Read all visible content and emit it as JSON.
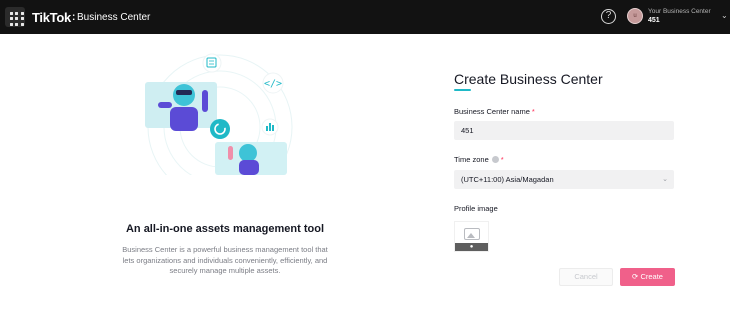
{
  "header": {
    "brand": "TikTok",
    "separator": ":",
    "product": "Business Center",
    "help_glyph": "?",
    "account_label": "Your Business Center",
    "account_id": "451",
    "avatar_initial": "u"
  },
  "intro": {
    "title": "An all-in-one assets management tool",
    "description": "Business Center is a powerful business management tool that lets organizations and individuals conveniently, efficiently, and securely manage multiple assets."
  },
  "form": {
    "title": "Create Business Center",
    "name_label": "Business Center name",
    "name_required_mark": "*",
    "name_value": "451",
    "timezone_label": "Time zone",
    "timezone_required_mark": "*",
    "timezone_value": "(UTC+11:00) Asia/Magadan",
    "profile_image_label": "Profile image",
    "cancel_label": "Cancel",
    "create_label": "Create"
  },
  "icons": {
    "apps": "grid-icon",
    "help": "help-circle-icon",
    "dropdown": "chevron-down-icon",
    "image": "image-placeholder-icon",
    "camera": "camera-icon",
    "loading": "spinner-icon"
  },
  "colors": {
    "accent_teal": "#1fb9c7",
    "create_pink": "#f0608a",
    "required_red": "#fe2c55",
    "topbar": "#121212"
  }
}
